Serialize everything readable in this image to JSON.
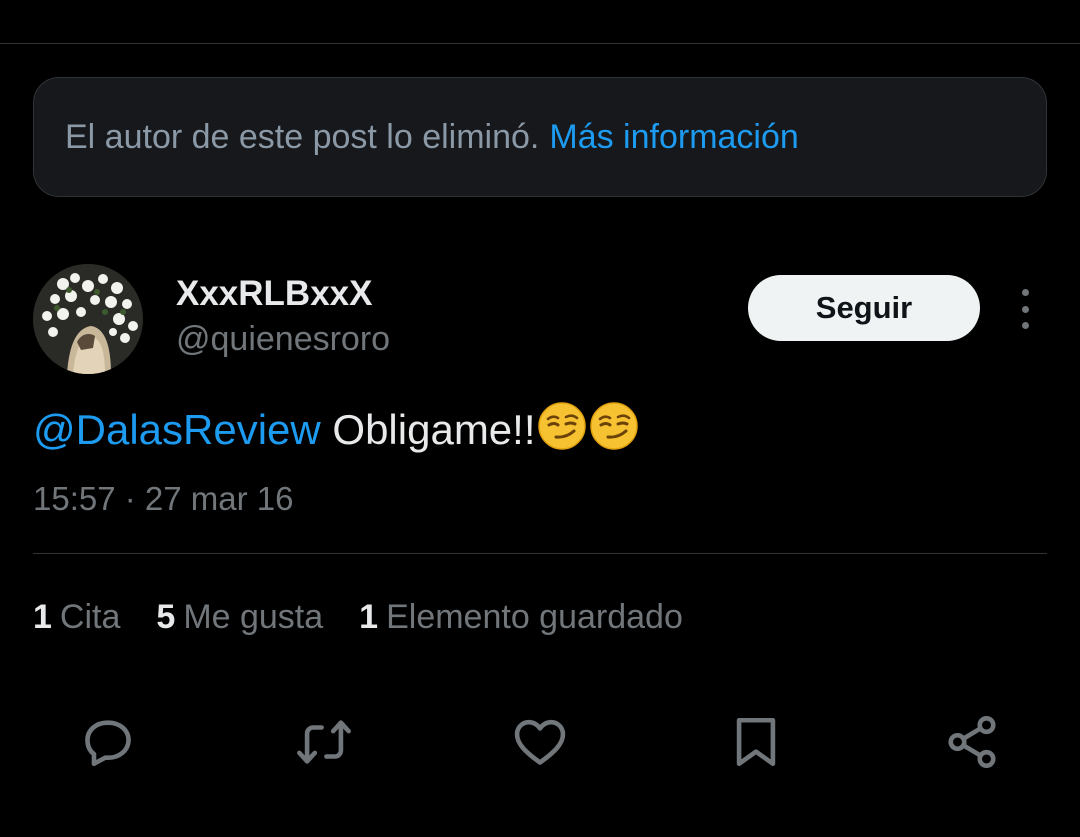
{
  "notice": {
    "text": "El autor de este post lo eliminó.",
    "link_label": "Más información"
  },
  "author": {
    "display_name": "XxxRLBxxX",
    "handle": "@quienesroro"
  },
  "follow_label": "Seguir",
  "tweet": {
    "mention": "@DalasReview",
    "body": "Obligame!!",
    "emojis": [
      "smirk-emoji",
      "smirk-emoji"
    ],
    "timestamp": "15:57 · 27 mar 16"
  },
  "stats": [
    {
      "count": "1",
      "label": "Cita"
    },
    {
      "count": "5",
      "label": "Me gusta"
    },
    {
      "count": "1",
      "label": "Elemento guardado"
    }
  ],
  "actions": [
    "reply-icon",
    "retweet-icon",
    "like-icon",
    "bookmark-icon",
    "share-icon"
  ],
  "colors": {
    "background": "#000000",
    "link": "#1d9bf0",
    "secondary_text": "#71767b",
    "primary_text": "#e7e9ea"
  }
}
